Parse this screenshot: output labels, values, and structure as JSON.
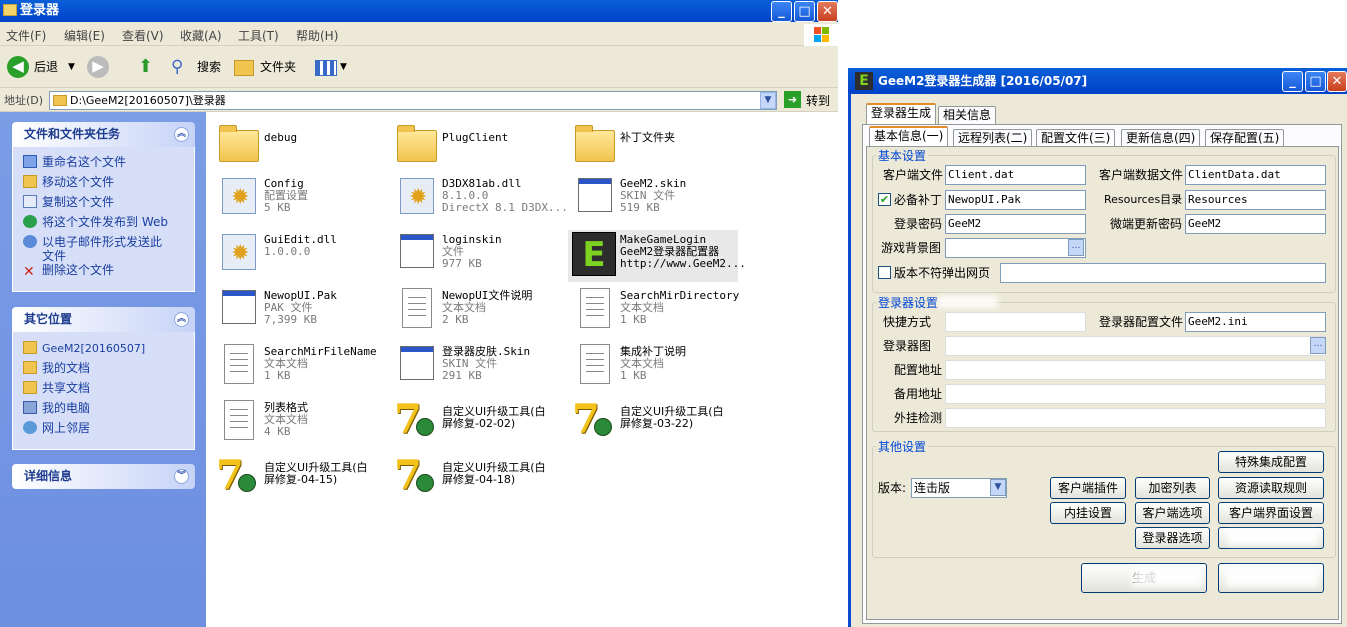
{
  "explorer": {
    "title": "登录器",
    "menu": [
      "文件(F)",
      "编辑(E)",
      "查看(V)",
      "收藏(A)",
      "工具(T)",
      "帮助(H)"
    ],
    "toolbar": {
      "back": "后退",
      "search": "搜索",
      "folders": "文件夹"
    },
    "address_label": "地址(D)",
    "address_value": "D:\\GeeM2[20160507]\\登录器",
    "go": "转到",
    "tasks_title": "文件和文件夹任务",
    "tasks": [
      "重命名这个文件",
      "移动这个文件",
      "复制这个文件",
      "将这个文件发布到 Web",
      "以电子邮件形式发送此",
      "文件",
      "删除这个文件"
    ],
    "places_title": "其它位置",
    "places": [
      "GeeM2[20160507]",
      "我的文档",
      "共享文档",
      "我的电脑",
      "网上邻居"
    ],
    "details_title": "详细信息",
    "files": [
      {
        "name": "debug",
        "l2": "",
        "l3": ""
      },
      {
        "name": "PlugClient",
        "l2": "",
        "l3": ""
      },
      {
        "name": "补丁文件夹",
        "l2": "",
        "l3": ""
      },
      {
        "name": "Config",
        "l2": "配置设置",
        "l3": "5 KB"
      },
      {
        "name": "D3DX81ab.dll",
        "l2": "8.1.0.0",
        "l3": "DirectX 8.1 D3DX..."
      },
      {
        "name": "GeeM2.skin",
        "l2": "SKIN 文件",
        "l3": "519 KB"
      },
      {
        "name": "GuiEdit.dll",
        "l2": "1.0.0.0",
        "l3": ""
      },
      {
        "name": "loginskin",
        "l2": "文件",
        "l3": "977 KB"
      },
      {
        "name": "MakeGameLogin",
        "l2": "GeeM2登录器配置器",
        "l3": "http://www.GeeM2..."
      },
      {
        "name": "NewopUI.Pak",
        "l2": "PAK 文件",
        "l3": "7,399 KB"
      },
      {
        "name": "NewopUI文件说明",
        "l2": "文本文档",
        "l3": "2 KB"
      },
      {
        "name": "SearchMirDirectory",
        "l2": "文本文档",
        "l3": "1 KB"
      },
      {
        "name": "SearchMirFileName",
        "l2": "文本文档",
        "l3": "1 KB"
      },
      {
        "name": "登录器皮肤.Skin",
        "l2": "SKIN 文件",
        "l3": "291 KB"
      },
      {
        "name": "集成补丁说明",
        "l2": "文本文档",
        "l3": "1 KB"
      },
      {
        "name": "列表格式",
        "l2": "文本文档",
        "l3": "4 KB"
      },
      {
        "name": "自定义UI升级工具(白",
        "l2": "屏修复-02-02)",
        "l3": ""
      },
      {
        "name": "自定义UI升级工具(白",
        "l2": "屏修复-03-22)",
        "l3": ""
      },
      {
        "name": "自定义UI升级工具(白",
        "l2": "屏修复-04-15)",
        "l3": ""
      },
      {
        "name": "自定义UI升级工具(白",
        "l2": "屏修复-04-18)",
        "l3": ""
      }
    ]
  },
  "generator": {
    "title": "GeeM2登录器生成器 [2016/05/07]",
    "top_tabs": [
      "登录器生成",
      "相关信息"
    ],
    "sub_tabs": [
      "基本信息(一)",
      "远程列表(二)",
      "配置文件(三)",
      "更新信息(四)",
      "保存配置(五)"
    ],
    "basic": {
      "group": "基本设置",
      "client_file_label": "客户端文件",
      "client_file": "Client.dat",
      "client_data_label": "客户端数据文件",
      "client_data": "ClientData.dat",
      "patch_label": "必备补丁",
      "patch": "NewopUI.Pak",
      "resources_label": "Resources目录",
      "resources": "Resources",
      "login_pw_label": "登录密码",
      "login_pw": "GeeM2",
      "update_pw_label": "微端更新密码",
      "update_pw": "GeeM2",
      "bg_label": "游戏背景图",
      "popup_label": "版本不符弹出网页"
    },
    "login": {
      "group": "登录器设置",
      "shortcut_label": "快捷方式",
      "config_label": "登录器配置文件",
      "config": "GeeM2.ini",
      "login_label": "登录器图",
      "cfg_addr_label": "配置地址",
      "backup_label": "备用地址",
      "plugin_check_label": "外挂检测"
    },
    "other": {
      "group": "其他设置",
      "version_label": "版本:",
      "version": "连击版",
      "buttons": [
        "特殊集成配置",
        "客户端插件",
        "加密列表",
        "资源读取规则",
        "内挂设置",
        "客户端选项",
        "客户端界面设置",
        "登录器选项"
      ],
      "generate": "生成"
    }
  }
}
